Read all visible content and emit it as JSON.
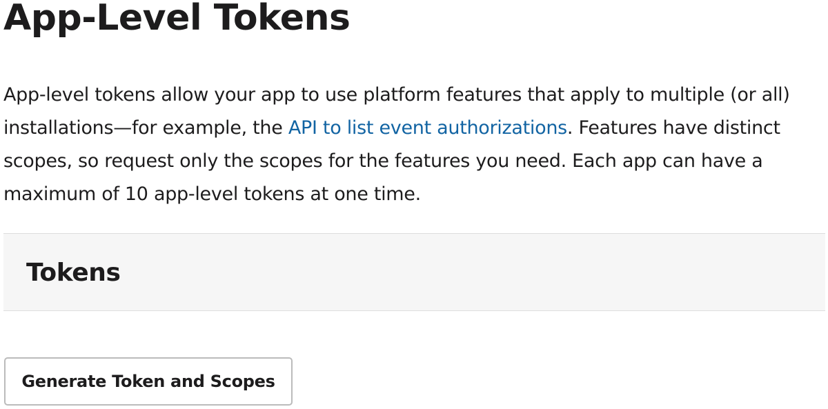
{
  "page": {
    "title": "App-Level Tokens"
  },
  "intro": {
    "text_before_link": "App-level tokens allow your app to use platform features that apply to multiple (or all) installations—for example, the ",
    "link_text": "API to list event authorizations",
    "text_after_link": ". Features have distinct scopes, so request only the scopes for the features you need. Each app can have a maximum of 10 app-level tokens at one time."
  },
  "tokens_section": {
    "title": "Tokens",
    "generate_button_label": "Generate Token and Scopes"
  },
  "colors": {
    "text": "#1d1c1d",
    "link": "#1264a3",
    "section_background": "#f6f6f6",
    "border": "#dddddd"
  }
}
